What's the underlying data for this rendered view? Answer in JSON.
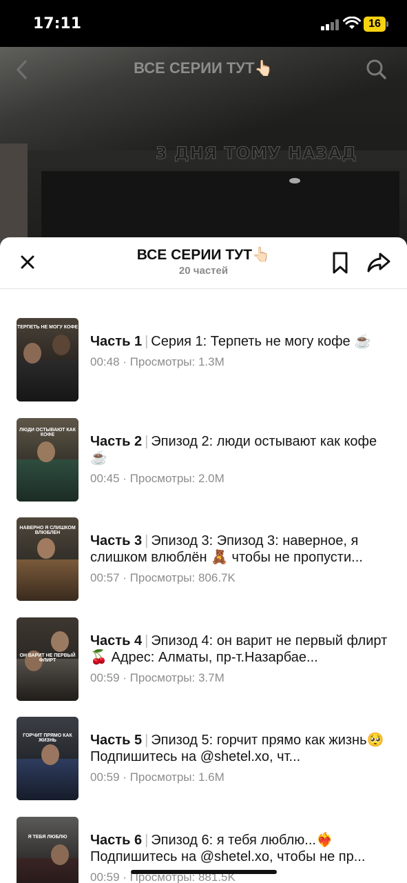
{
  "status_bar": {
    "time": "17:11",
    "battery": "16"
  },
  "video": {
    "title": "ВСЕ СЕРИИ ТУТ👆🏻",
    "caption": "3 ДНЯ ТОМУ НАЗАД",
    "icons": {
      "back": "back-chevron-icon",
      "search": "search-icon"
    }
  },
  "sheet": {
    "title": "ВСЕ СЕРИИ ТУТ👆🏻",
    "subtitle": "20 частей",
    "icons": {
      "close": "close-icon",
      "bookmark": "bookmark-icon",
      "share": "share-icon"
    }
  },
  "episodes": [
    {
      "part": "Часть 1",
      "title": "Серия 1: Терпеть не могу кофе ☕",
      "duration": "00:48",
      "views_label": "Просмотры: 1.3M",
      "thumb_text": "ТЕРПЕТЬ НЕ МОГУ КОФЕ"
    },
    {
      "part": "Часть 2",
      "title": "Эпизод 2: люди остывают как кофе☕",
      "duration": "00:45",
      "views_label": "Просмотры: 2.0M",
      "thumb_text": "ЛЮДИ ОСТЫВАЮТ КАК КОФЕ"
    },
    {
      "part": "Часть 3",
      "title": "Эпизод 3: Эпизод 3: наверное, я слишком влюблён 🧸 чтобы не пропусти...",
      "duration": "00:57",
      "views_label": "Просмотры: 806.7K",
      "thumb_text": "НАВЕРНО Я СЛИШКОМ ВЛЮБЛЕН"
    },
    {
      "part": "Часть 4",
      "title": "Эпизод 4: он варит не первый флирт🍒 Адрес: Алматы, пр-т.Назарбае...",
      "duration": "00:59",
      "views_label": "Просмотры: 3.7M",
      "thumb_text": "ОН ВАРИТ НЕ ПЕРВЫЙ ФЛИРТ"
    },
    {
      "part": "Часть 5",
      "title": "Эпизод 5: горчит прямо как жизнь🥺 Подпишитесь на @shetel.xo, чт...",
      "duration": "00:59",
      "views_label": "Просмотры: 1.6M",
      "thumb_text": "ГОРЧИТ ПРЯМО КАК ЖИЗНЬ"
    },
    {
      "part": "Часть 6",
      "title": "Эпизод 6: я тебя люблю...❤️‍🔥 Подпишитесь на @shetel.xo, чтобы не пр...",
      "duration": "00:59",
      "views_label": "Просмотры: 881.5K",
      "thumb_text": "Я ТЕБЯ ЛЮБЛЮ"
    }
  ],
  "colors": {
    "sheet_bg": "#ffffff",
    "text": "#161616",
    "meta": "#8c8c8c",
    "battery": "#f5d10f"
  }
}
